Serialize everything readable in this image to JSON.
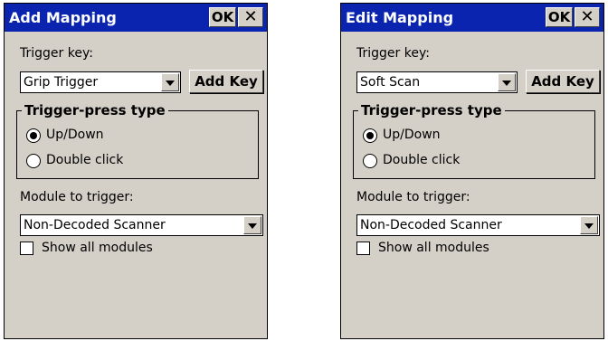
{
  "dialogs": [
    {
      "title": "Add Mapping",
      "ok_label": "OK",
      "close_label": "✕",
      "trigger_key_label": "Trigger key:",
      "trigger_key_value": "Grip Trigger",
      "add_key_label": "Add Key",
      "group_title": "Trigger-press type",
      "radio_updown": "Up/Down",
      "radio_double": "Double click",
      "selected_press_type": "Up/Down",
      "module_label": "Module to trigger:",
      "module_value": "Non-Decoded Scanner",
      "show_all_label": "Show all modules",
      "show_all_checked": false
    },
    {
      "title": "Edit Mapping",
      "ok_label": "OK",
      "close_label": "✕",
      "trigger_key_label": "Trigger key:",
      "trigger_key_value": "Soft Scan",
      "add_key_label": "Add Key",
      "group_title": "Trigger-press type",
      "radio_updown": "Up/Down",
      "radio_double": "Double click",
      "selected_press_type": "Up/Down",
      "module_label": "Module to trigger:",
      "module_value": "Non-Decoded Scanner",
      "show_all_label": "Show all modules",
      "show_all_checked": false
    }
  ],
  "colors": {
    "titlebar": "#0a24b0",
    "dialog_bg": "#d4d0c8"
  }
}
